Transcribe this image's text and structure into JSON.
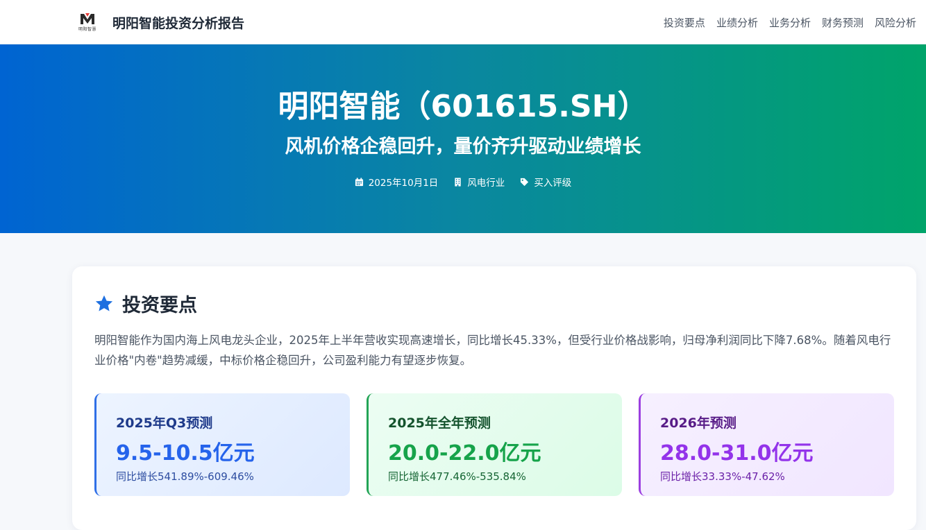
{
  "header": {
    "logo_text": "明阳智慧",
    "title": "明阳智能投资分析报告",
    "nav": [
      {
        "label": "投资要点"
      },
      {
        "label": "业绩分析"
      },
      {
        "label": "业务分析"
      },
      {
        "label": "财务预测"
      },
      {
        "label": "风险分析"
      }
    ]
  },
  "hero": {
    "title": "明阳智能（601615.SH）",
    "subtitle": "风机价格企稳回升，量价齐升驱动业绩增长",
    "meta": {
      "date": "2025年10月1日",
      "industry": "风电行业",
      "rating": "买入评级"
    }
  },
  "highlights": {
    "title": "投资要点",
    "summary": "明阳智能作为国内海上风电龙头企业，2025年上半年营收实现高速增长，同比增长45.33%，但受行业价格战影响，归母净利润同比下降7.68%。随着风电行业价格\"内卷\"趋势减缓，中标价格企稳回升，公司盈利能力有望逐步恢复。",
    "forecasts": [
      {
        "label": "2025年Q3预测",
        "value": "9.5-10.5亿元",
        "note": "同比增长541.89%-609.46%",
        "accent": "#2563eb"
      },
      {
        "label": "2025年全年预测",
        "value": "20.0-22.0亿元",
        "note": "同比增长477.46%-535.84%",
        "accent": "#16a34a"
      },
      {
        "label": "2026年预测",
        "value": "28.0-31.0亿元",
        "note": "同比增长33.33%-47.62%",
        "accent": "#9333ea"
      }
    ]
  },
  "colors": {
    "hero_gradient_start": "#0064d2",
    "hero_gradient_end": "#00a46a",
    "star_icon": "#1d6fe0"
  }
}
